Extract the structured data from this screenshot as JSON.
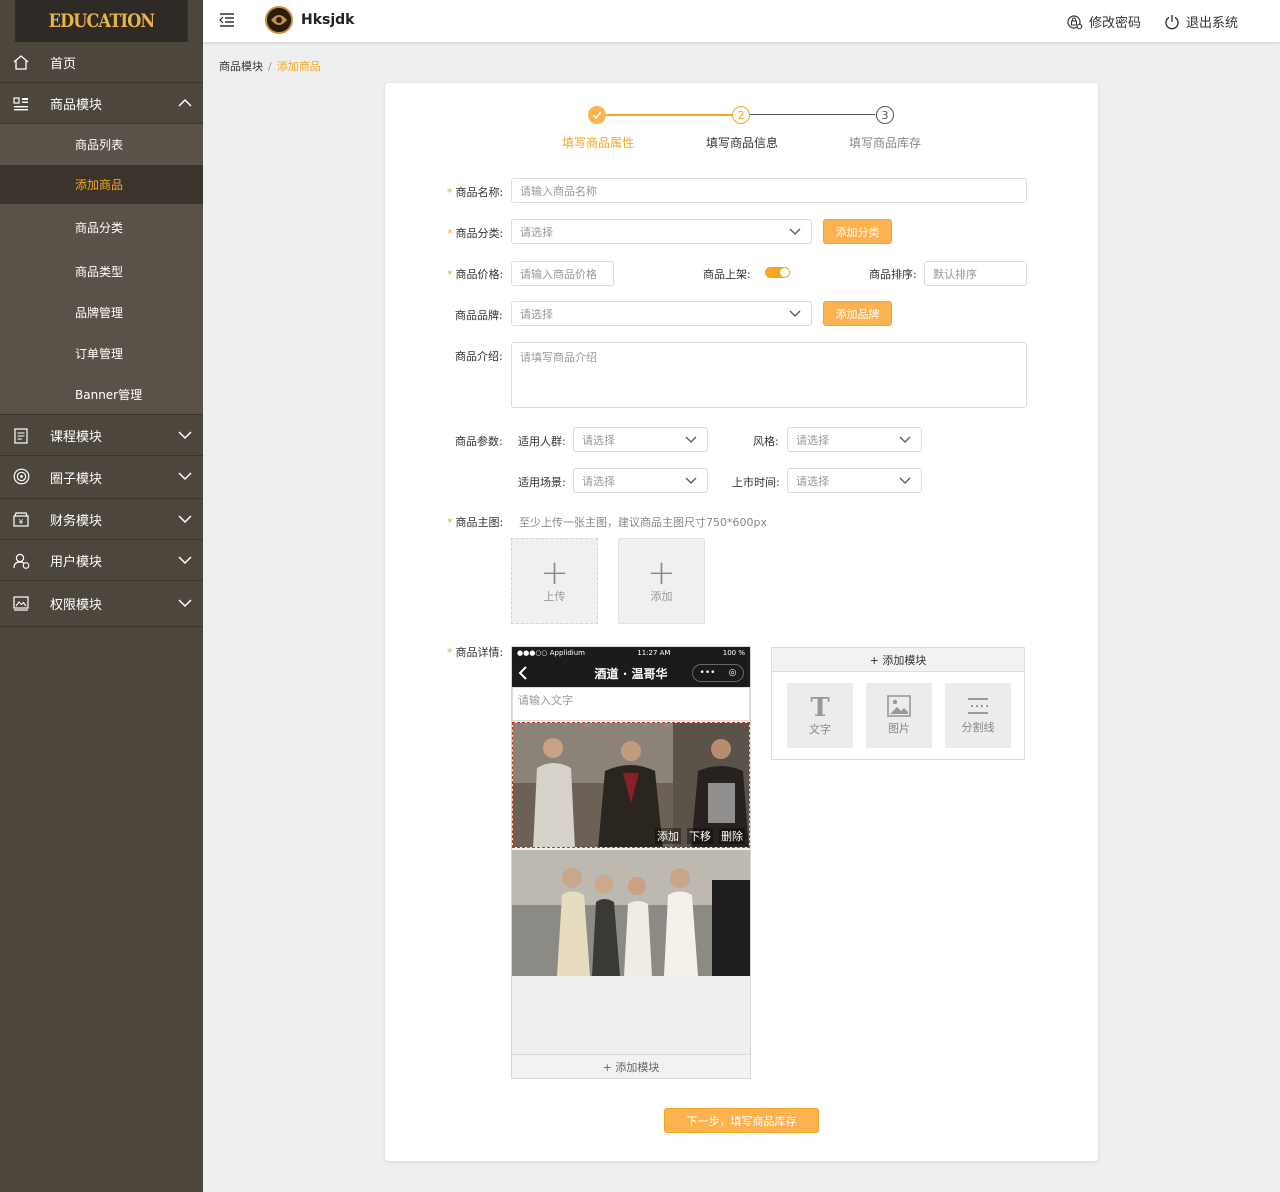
{
  "app": {
    "logo_text": "EDUCATION"
  },
  "sidebar": {
    "items": [
      {
        "label": "首页",
        "icon": "home-icon"
      },
      {
        "label": "商品模块",
        "icon": "grid-icon",
        "expanded": true
      },
      {
        "label": "课程模块",
        "icon": "document-icon"
      },
      {
        "label": "圈子模块",
        "icon": "target-icon"
      },
      {
        "label": "财务模块",
        "icon": "wallet-icon"
      },
      {
        "label": "用户模块",
        "icon": "user-icon"
      },
      {
        "label": "权限模块",
        "icon": "image-icon"
      }
    ],
    "sub_items": [
      "商品列表",
      "添加商品",
      "商品分类",
      "商品类型",
      "品牌管理",
      "订单管理",
      "Banner管理"
    ],
    "active_sub": "添加商品"
  },
  "topbar": {
    "username": "Hksjdk",
    "change_password": "修改密码",
    "logout": "退出系统"
  },
  "breadcrumb": {
    "parent": "商品模块",
    "separator": "/",
    "current": "添加商品"
  },
  "steps": [
    {
      "label": "填写商品属性",
      "number": "1",
      "state": "done"
    },
    {
      "label": "填写商品信息",
      "number": "2",
      "state": "active"
    },
    {
      "label": "填写商品库存",
      "number": "3",
      "state": "pending"
    }
  ],
  "form": {
    "name": {
      "label": "商品名称:",
      "placeholder": "请输入商品名称"
    },
    "category": {
      "label": "商品分类:",
      "placeholder": "请选择",
      "button": "添加分类"
    },
    "price": {
      "label": "商品价格:",
      "placeholder": "请输入商品价格"
    },
    "onsale": {
      "label": "商品上架:",
      "value": true
    },
    "sort": {
      "label": "商品排序:",
      "placeholder": "默认排序"
    },
    "brand": {
      "label": "商品品牌:",
      "placeholder": "请选择",
      "button": "添加品牌"
    },
    "intro": {
      "label": "商品介绍:",
      "placeholder": "请填写商品介绍"
    },
    "params": {
      "label": "商品参数:",
      "crowd": {
        "label": "适用人群:",
        "placeholder": "请选择"
      },
      "style": {
        "label": "风格:",
        "placeholder": "请选择"
      },
      "scene": {
        "label": "适用场景:",
        "placeholder": "请选择"
      },
      "launch": {
        "label": "上市时间:",
        "placeholder": "请选择"
      }
    },
    "main_image": {
      "label": "商品主图:",
      "hint": "至少上传一张主图，建议商品主图尺寸750*600px",
      "upload": "上传",
      "add": "添加"
    },
    "detail": {
      "label": "商品详情:"
    }
  },
  "phone": {
    "carrier": "●●●○○ Applidium",
    "time": "11:27 AM",
    "battery": "100 %",
    "title": "酒道 · 温哥华",
    "text_placeholder": "请输入文字",
    "photo_actions": [
      "添加",
      "下移",
      "删除"
    ],
    "add_module": "+ 添加模块"
  },
  "module_panel": {
    "title": "+ 添加模块",
    "tiles": [
      {
        "label": "文字",
        "icon": "text-icon"
      },
      {
        "label": "图片",
        "icon": "picture-icon"
      },
      {
        "label": "分割线",
        "icon": "divider-icon"
      }
    ]
  },
  "next_button": "下一步，填写商品库存",
  "colors": {
    "accent": "#f5a623",
    "sidebar": "#4d463d",
    "sidebar_dark": "#2e2b26"
  }
}
